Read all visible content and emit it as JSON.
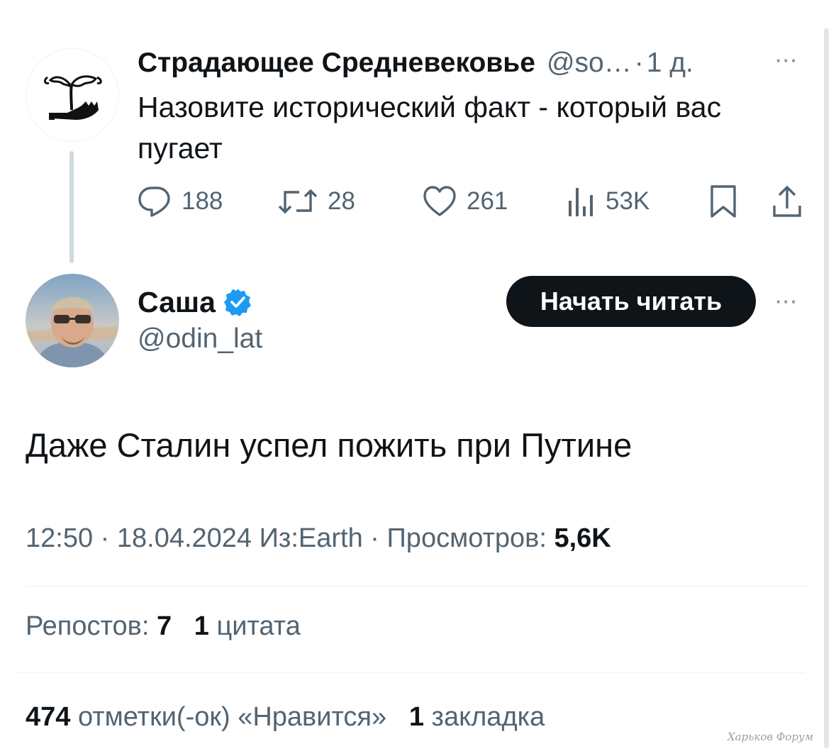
{
  "parent_tweet": {
    "display_name": "Страдающее Средневековье",
    "handle": "@so…",
    "separator": "·",
    "time": "1 д.",
    "more_label": "···",
    "text": "Назовите исторический факт - который вас пугает",
    "actions": {
      "replies": "188",
      "retweets": "28",
      "likes": "261",
      "views": "53K"
    }
  },
  "main_tweet": {
    "display_name": "Саша",
    "handle": "@odin_lat",
    "follow_label": "Начать читать",
    "more_label": "···",
    "text": "Даже Сталин успел пожить при Путине",
    "meta_prefix": "12:50 · 18.04.2024 Из:Earth · Просмотров: ",
    "views": "5,6K",
    "reposts_label": "Репостов: ",
    "reposts_count": "7",
    "quotes_count": "1",
    "quotes_label": " цитата",
    "likes_count": "474",
    "likes_label": " отметки(-ок) «Нравится» ",
    "bookmarks_count": "1",
    "bookmarks_label": " закладка"
  },
  "icons": {
    "verified_color": "#1d9bf0",
    "names": [
      "reply-icon",
      "retweet-icon",
      "like-icon",
      "views-icon",
      "bookmark-icon",
      "share-icon",
      "verified-badge-icon"
    ]
  },
  "watermark": "Харьков Форум"
}
